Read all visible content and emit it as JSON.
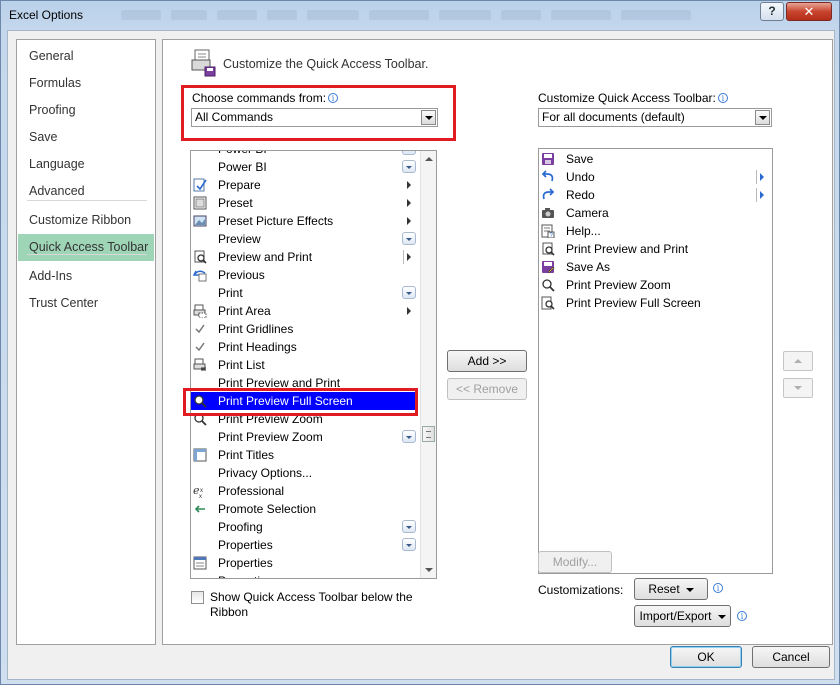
{
  "window": {
    "title": "Excel Options",
    "help_label": "?",
    "close_label": "✕"
  },
  "nav": {
    "items": [
      {
        "label": "General"
      },
      {
        "label": "Formulas"
      },
      {
        "label": "Proofing"
      },
      {
        "label": "Save"
      },
      {
        "label": "Language"
      },
      {
        "label": "Advanced"
      },
      {
        "label": "Customize Ribbon"
      },
      {
        "label": "Quick Access Toolbar",
        "selected": true
      },
      {
        "label": "Add-Ins"
      },
      {
        "label": "Trust Center"
      }
    ]
  },
  "header": {
    "title": "Customize the Quick Access Toolbar.",
    "icon": "toolbar-icon"
  },
  "left": {
    "choose_label": "Choose commands from:",
    "choose_value": "All Commands",
    "commands": [
      {
        "label": "Power BI",
        "icon": "",
        "suffix": "dropdown"
      },
      {
        "label": "Power BI",
        "icon": "",
        "suffix": "dropdown"
      },
      {
        "label": "Prepare",
        "icon": "prepare-icon",
        "suffix": "arrow"
      },
      {
        "label": "Preset",
        "icon": "preset-icon",
        "suffix": "arrow"
      },
      {
        "label": "Preset Picture Effects",
        "icon": "picture-effects-icon",
        "suffix": "arrow"
      },
      {
        "label": "Preview",
        "icon": "",
        "suffix": "dropdown"
      },
      {
        "label": "Preview and Print",
        "icon": "preview-print-icon",
        "suffix": "split-arrow"
      },
      {
        "label": "Previous",
        "icon": "previous-icon",
        "suffix": ""
      },
      {
        "label": "Print",
        "icon": "",
        "suffix": "dropdown"
      },
      {
        "label": "Print Area",
        "icon": "print-area-icon",
        "suffix": "arrow"
      },
      {
        "label": "Print Gridlines",
        "icon": "check-icon",
        "suffix": ""
      },
      {
        "label": "Print Headings",
        "icon": "check-icon",
        "suffix": ""
      },
      {
        "label": "Print List",
        "icon": "print-list-icon",
        "suffix": ""
      },
      {
        "label": "Print Preview and Print",
        "icon": "",
        "suffix": ""
      },
      {
        "label": "Print Preview Full Screen",
        "icon": "magnifier-icon",
        "suffix": "",
        "selected": true
      },
      {
        "label": "Print Preview Zoom",
        "icon": "magnifier-icon",
        "suffix": ""
      },
      {
        "label": "Print Preview Zoom",
        "icon": "",
        "suffix": "dropdown"
      },
      {
        "label": "Print Titles",
        "icon": "print-titles-icon",
        "suffix": ""
      },
      {
        "label": "Privacy Options...",
        "icon": "",
        "suffix": ""
      },
      {
        "label": "Professional",
        "icon": "professional-icon",
        "suffix": ""
      },
      {
        "label": "Promote Selection",
        "icon": "promote-icon",
        "suffix": ""
      },
      {
        "label": "Proofing",
        "icon": "",
        "suffix": "dropdown"
      },
      {
        "label": "Properties",
        "icon": "",
        "suffix": "dropdown"
      },
      {
        "label": "Properties",
        "icon": "properties-icon",
        "suffix": ""
      },
      {
        "label": "Properties",
        "icon": "",
        "suffix": ""
      }
    ],
    "checkbox_label_line1": "Show Quick Access Toolbar below the",
    "checkbox_label_line2": "Ribbon"
  },
  "middle": {
    "add_label": "Add >>",
    "remove_label": "<< Remove"
  },
  "right": {
    "customize_label": "Customize Quick Access Toolbar:",
    "scope_value": "For all documents (default)",
    "toolbar_items": [
      {
        "label": "Save",
        "icon": "save-icon",
        "suffix": ""
      },
      {
        "label": "Undo",
        "icon": "undo-icon",
        "suffix": "split-arrow"
      },
      {
        "label": "Redo",
        "icon": "redo-icon",
        "suffix": "split-arrow"
      },
      {
        "label": "Camera",
        "icon": "camera-icon",
        "suffix": ""
      },
      {
        "label": "Help...",
        "icon": "help-icon",
        "suffix": ""
      },
      {
        "label": "Print Preview and Print",
        "icon": "preview-print-icon",
        "suffix": ""
      },
      {
        "label": "Save As",
        "icon": "save-as-icon",
        "suffix": ""
      },
      {
        "label": "Print Preview Zoom",
        "icon": "magnifier-icon",
        "suffix": ""
      },
      {
        "label": "Print Preview Full Screen",
        "icon": "preview-full-icon",
        "suffix": ""
      }
    ],
    "modify_label": "Modify...",
    "customizations_label": "Customizations:",
    "reset_label": "Reset",
    "import_export_label": "Import/Export"
  },
  "footer": {
    "ok_label": "OK",
    "cancel_label": "Cancel"
  }
}
